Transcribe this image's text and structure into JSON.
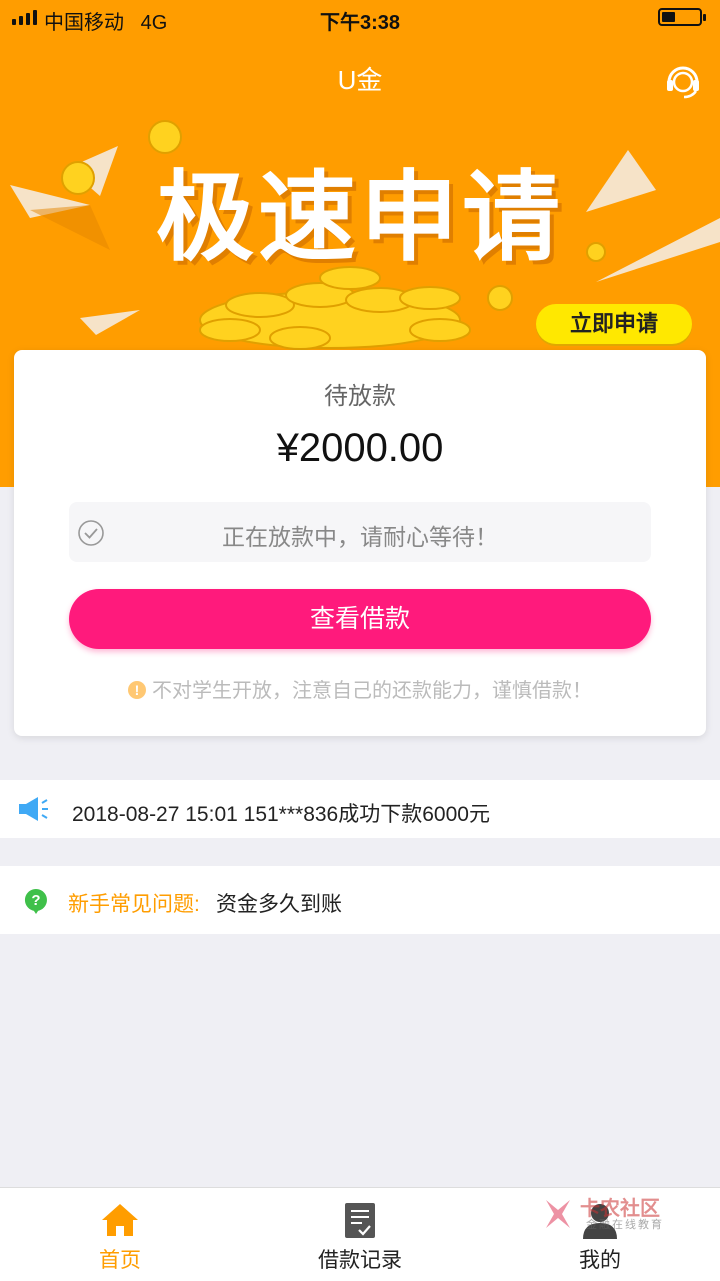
{
  "status_bar": {
    "carrier": "中国移动",
    "network": "4G",
    "time": "下午3:38",
    "battery_level": 0.35
  },
  "header": {
    "title": "U金",
    "support_icon": "headset-icon"
  },
  "banner": {
    "headline": "极速申请",
    "cta_label": "立即申请"
  },
  "loan_card": {
    "status": "待放款",
    "amount": "¥2000.00",
    "progress_message": "正在放款中，请耐心等待！",
    "view_button": "查看借款",
    "warning": "不对学生开放，注意自己的还款能力，谨慎借款！"
  },
  "ticker": {
    "message": "2018-08-27 15:01 151***836成功下款6000元"
  },
  "faq": {
    "label": "新手常见问题:",
    "question": "资金多久到账"
  },
  "tabbar": {
    "items": [
      {
        "label": "首页",
        "icon": "home-icon",
        "active": true
      },
      {
        "label": "借款记录",
        "icon": "document-icon",
        "active": false
      },
      {
        "label": "我的",
        "icon": "user-icon",
        "active": false
      }
    ]
  },
  "watermark": {
    "text": "卡农社区",
    "subtext": "金融在线教育"
  },
  "colors": {
    "primary": "#ff9d00",
    "accent_button": "#ff1a7c",
    "banner_cta": "#ffe800",
    "background": "#efeff4"
  }
}
